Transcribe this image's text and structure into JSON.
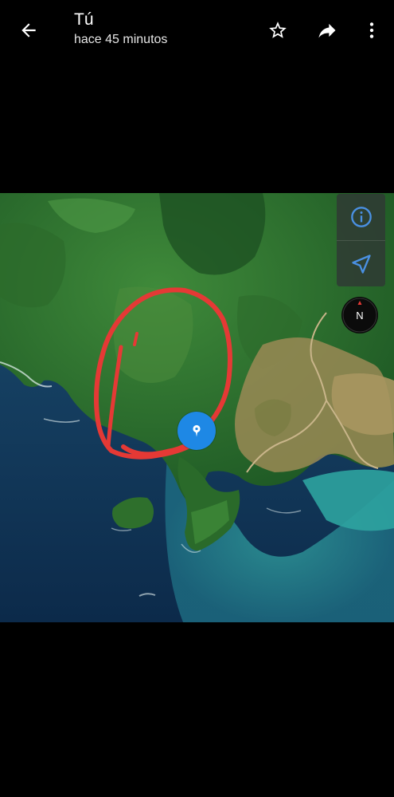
{
  "header": {
    "title": "Tú",
    "subtitle": "hace 45 minutos",
    "icons": {
      "back": "arrow-left-icon",
      "star": "star-outline-icon",
      "share": "share-arrow-icon",
      "more": "more-vert-icon"
    }
  },
  "map": {
    "view": "satellite",
    "controls": {
      "info_icon": "info-icon",
      "navigate_icon": "navigation-arrow-icon",
      "compass_label": "N"
    },
    "location_pin_icon": "location-pin-icon",
    "annotation_color": "#e53935"
  },
  "colors": {
    "background": "#000000",
    "accent": "#1e88e5",
    "control_icon": "#4a90e2"
  }
}
